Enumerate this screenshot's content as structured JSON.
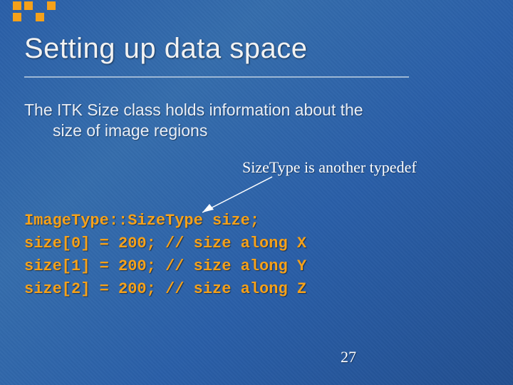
{
  "title": "Setting up data space",
  "body": {
    "line1": "The ITK Size class holds information about the",
    "line2": "size of image regions"
  },
  "annotation": "SizeType is another typedef",
  "code": {
    "line1": "ImageType::SizeType size;",
    "line2": "size[0] = 200; // size along X",
    "line3": "size[1] = 200; // size along Y",
    "line4": "size[2] = 200; // size along Z"
  },
  "pageNumber": "27",
  "accentColor": "#f5a11a"
}
